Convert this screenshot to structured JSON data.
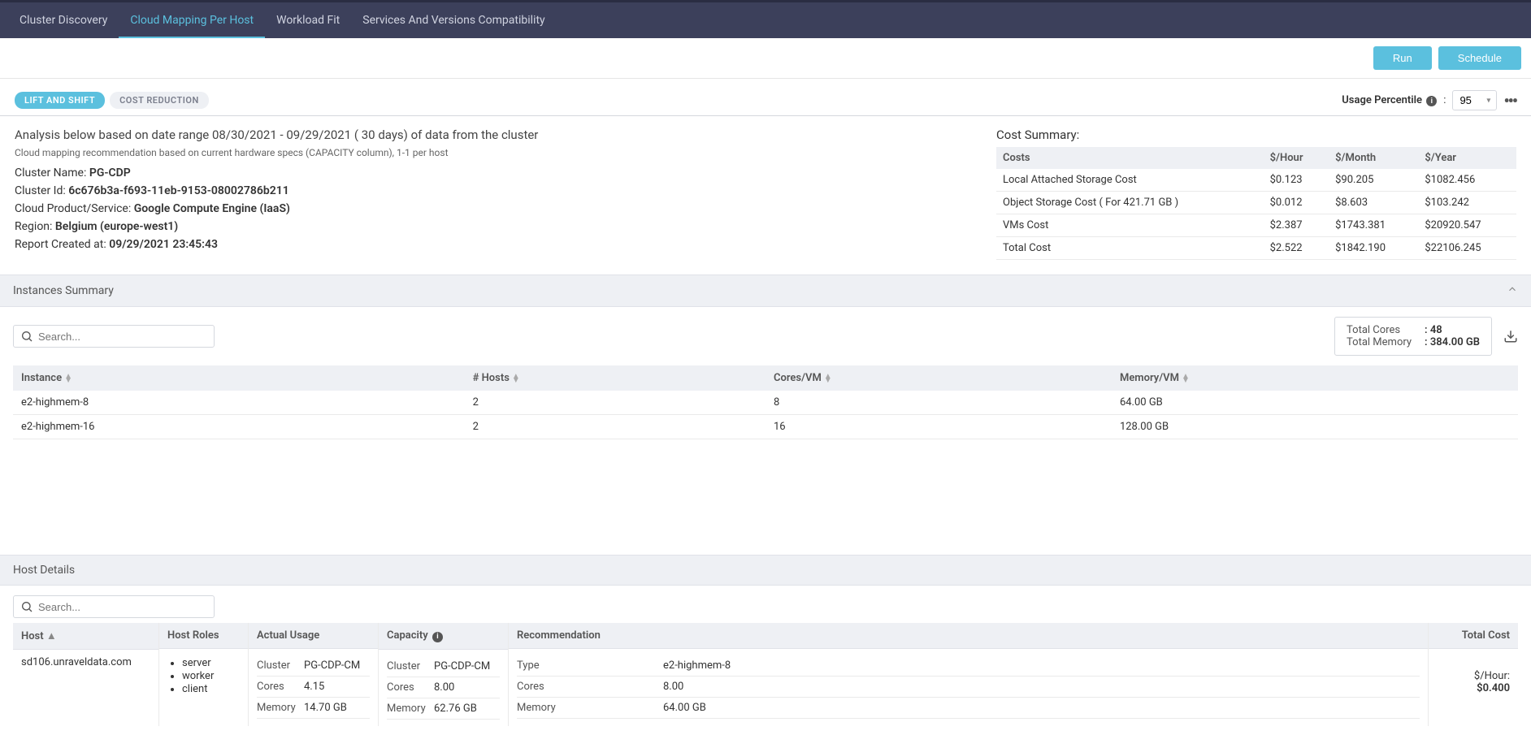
{
  "nav": {
    "tabs": [
      "Cluster Discovery",
      "Cloud Mapping Per Host",
      "Workload Fit",
      "Services And Versions Compatibility"
    ],
    "active": 1
  },
  "actions": {
    "run": "Run",
    "schedule": "Schedule"
  },
  "pills": {
    "lift": "LIFT AND SHIFT",
    "cost": "COST REDUCTION"
  },
  "usage": {
    "label": "Usage Percentile",
    "value": "95"
  },
  "analysis": {
    "title": "Analysis below based on date range 08/30/2021 - 09/29/2021 ( 30 days) of data from the cluster",
    "sub": "Cloud mapping recommendation based on current hardware specs (CAPACITY column), 1-1 per host",
    "cluster_name_label": "Cluster Name: ",
    "cluster_name": "PG-CDP",
    "cluster_id_label": "Cluster Id: ",
    "cluster_id": "6c676b3a-f693-11eb-9153-08002786b211",
    "product_label": "Cloud Product/Service: ",
    "product": "Google Compute Engine (IaaS)",
    "region_label": "Region: ",
    "region": "Belgium (europe-west1)",
    "created_label": "Report Created at: ",
    "created": "09/29/2021 23:45:43"
  },
  "cost_summary": {
    "title": "Cost Summary:",
    "headers": [
      "Costs",
      "$/Hour",
      "$/Month",
      "$/Year"
    ],
    "rows": [
      [
        "Local Attached Storage Cost",
        "$0.123",
        "$90.205",
        "$1082.456"
      ],
      [
        "Object Storage Cost ( For 421.71 GB )",
        "$0.012",
        "$8.603",
        "$103.242"
      ],
      [
        "VMs Cost",
        "$2.387",
        "$1743.381",
        "$20920.547"
      ],
      [
        "Total Cost",
        "$2.522",
        "$1842.190",
        "$22106.245"
      ]
    ]
  },
  "instances": {
    "title": "Instances Summary",
    "search_ph": "Search...",
    "totals": {
      "cores_label": "Total Cores",
      "cores": ": 48",
      "mem_label": "Total Memory",
      "mem": ": 384.00 GB"
    },
    "headers": [
      "Instance",
      "# Hosts",
      "Cores/VM",
      "Memory/VM"
    ],
    "rows": [
      [
        "e2-highmem-8",
        "2",
        "8",
        "64.00 GB"
      ],
      [
        "e2-highmem-16",
        "2",
        "16",
        "128.00 GB"
      ]
    ]
  },
  "host_details": {
    "title": "Host Details",
    "search_ph": "Search...",
    "headers": {
      "host": "Host",
      "roles": "Host Roles",
      "usage": "Actual Usage",
      "capacity": "Capacity",
      "rec": "Recommendation",
      "total": "Total Cost"
    },
    "row": {
      "host": "sd106.unraveldata.com",
      "roles": [
        "server",
        "worker",
        "client"
      ],
      "usage": {
        "Cluster": "PG-CDP-CM",
        "Cores": "4.15",
        "Memory": "14.70 GB"
      },
      "capacity": {
        "Cluster": "PG-CDP-CM",
        "Cores": "8.00",
        "Memory": "62.76 GB"
      },
      "rec": {
        "Type": "e2-highmem-8",
        "Cores": "8.00",
        "Memory": "64.00 GB"
      },
      "cost": {
        "hour_label": "$/Hour:",
        "hour": "$0.400"
      }
    }
  }
}
